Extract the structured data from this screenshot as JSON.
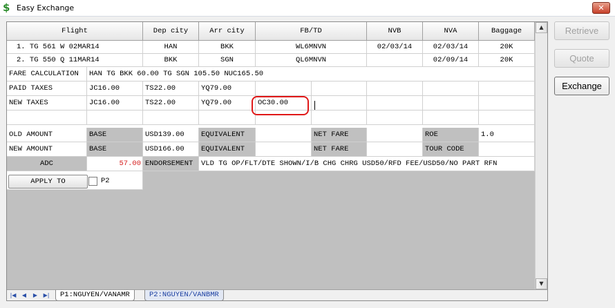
{
  "window": {
    "title": "Easy Exchange",
    "close_label": "✕"
  },
  "columns": [
    "Flight",
    "Dep city",
    "Arr city",
    "FB/TD",
    "NVB",
    "NVA",
    "Baggage"
  ],
  "flights": [
    {
      "flight": "1. TG  561 W  02MAR14",
      "dep": "HAN",
      "arr": "BKK",
      "fb": "WL6MNVN",
      "nvb": "02/03/14",
      "nva": "02/03/14",
      "bag": "20K"
    },
    {
      "flight": "2. TG  550 Q  11MAR14",
      "dep": "BKK",
      "arr": "SGN",
      "fb": "QL6MNVN",
      "nvb": "",
      "nva": "02/09/14",
      "bag": "20K"
    }
  ],
  "fare_calc": {
    "label": "FARE CALCULATION",
    "value": "HAN TG BKK 60.00 TG SGN 105.50 NUC165.50"
  },
  "paid_taxes": {
    "label": "PAID TAXES",
    "t1": "JC16.00",
    "t2": "TS22.00",
    "t3": "YQ79.00"
  },
  "new_taxes": {
    "label": "NEW TAXES",
    "t1": "JC16.00",
    "t2": "TS22.00",
    "t3": "YQ79.00",
    "t4": "OC30.00"
  },
  "old_amount": {
    "label": "OLD AMOUNT",
    "base_label": "BASE",
    "base": "USD139.00",
    "equiv_label": "EQUIVALENT",
    "net_label": "NET FARE",
    "roe_label": "ROE",
    "roe": "1.0"
  },
  "new_amount": {
    "label": "NEW AMOUNT",
    "base_label": "BASE",
    "base": "USD166.00",
    "equiv_label": "EQUIVALENT",
    "net_label": "NET FARE",
    "tour_label": "TOUR CODE"
  },
  "adc": {
    "label": "ADC",
    "value": "57.00",
    "endorse_label": "ENDORSEMENT",
    "endorse": "VLD  TG OP/FLT/DTE SHOWN/I/B CHG CHRG USD50/RFD FEE/USD50/NO PART RFN"
  },
  "apply": {
    "label": "APPLY TO",
    "checkbox_label": "P2"
  },
  "tabs": [
    "P1:NGUYEN/VANAMR",
    "P2:NGUYEN/VANBMR"
  ],
  "buttons": {
    "retrieve": "Retrieve",
    "quote": "Quote",
    "exchange": "Exchange"
  }
}
